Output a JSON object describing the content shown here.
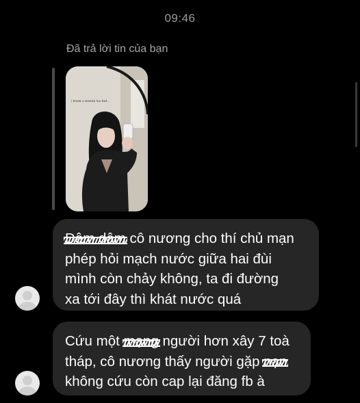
{
  "chat": {
    "timestamp": "09:46",
    "reply_label": "Đã trả lời tin của bạn",
    "reply_photo_caption": "i know u wanna luv but...",
    "messages": [
      {
        "lines": [
          [
            "Dâm dâm",
            " cô nương cho thí chủ mạn"
          ],
          [
            "phép hỏi mạch nước giữa hai đùi"
          ],
          [
            "mình còn chảy không, ta đi đường"
          ],
          [
            "xa tới đây thì khát nước quá"
          ]
        ]
      },
      {
        "lines": [
          [
            "Cứu một ",
            "mạng",
            " người hơn xây 7 toà"
          ],
          [
            "tháp, cô nương thấy người gặp ",
            "nạn"
          ],
          [
            "không cứu còn cap lại đăng fb à"
          ]
        ]
      }
    ],
    "avatar_icon": "default-profile-avatar-icon"
  }
}
